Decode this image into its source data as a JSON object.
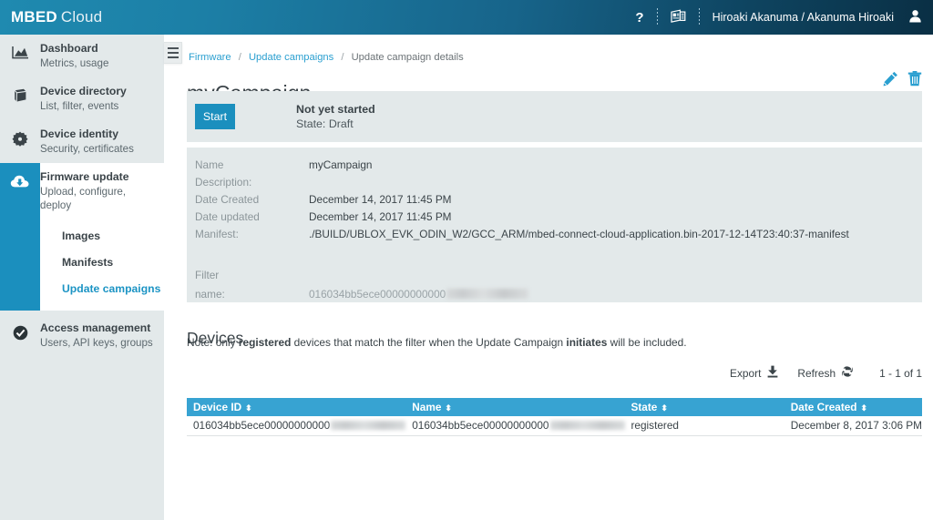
{
  "topbar": {
    "brand_bold": "MBED",
    "brand_light": "Cloud",
    "help_label": "?",
    "news_icon": "newspaper-icon",
    "user_name": "Hiroaki Akanuma / Akanuma Hiroaki",
    "avatar_icon": "user-avatar-icon",
    "gradient_from": "#1f8ab0",
    "gradient_to": "#0a2f44"
  },
  "sidebar": {
    "items": [
      {
        "icon": "area-chart-icon",
        "title": "Dashboard",
        "sub": "Metrics, usage"
      },
      {
        "icon": "book-icon",
        "title": "Device directory",
        "sub": "List, filter, events"
      },
      {
        "icon": "gear-badge-icon",
        "title": "Device identity",
        "sub": "Security, certificates"
      },
      {
        "icon": "cloud-download-icon",
        "title": "Firmware update",
        "sub": "Upload, configure, deploy"
      },
      {
        "icon": "check-circle-icon",
        "title": "Access management",
        "sub": "Users, API keys, groups"
      }
    ],
    "subitems": [
      {
        "label": "Images",
        "current": false
      },
      {
        "label": "Manifests",
        "current": false
      },
      {
        "label": "Update campaigns",
        "current": true
      }
    ],
    "active_color": "#1b8fbe",
    "bg_color": "#e3e9ea"
  },
  "breadcrumb": {
    "items": [
      {
        "label": "Firmware",
        "link": true
      },
      {
        "label": "Update campaigns",
        "link": true
      },
      {
        "label": "Update campaign details",
        "link": false
      }
    ],
    "separator": "/"
  },
  "page": {
    "title": "myCampaign",
    "edit_icon": "pencil-icon",
    "delete_icon": "trash-icon",
    "accent_color": "#2a9fd0"
  },
  "status": {
    "start_label": "Start",
    "headline": "Not yet started",
    "state": "State: Draft"
  },
  "details": {
    "rows": [
      {
        "label": "Name",
        "value": "myCampaign"
      },
      {
        "label": "Description:",
        "value": ""
      },
      {
        "label": "Date Created",
        "value": "December 14, 2017 11:45 PM"
      },
      {
        "label": "Date updated",
        "value": "December 14, 2017 11:45 PM"
      },
      {
        "label": "Manifest:",
        "value": "./BUILD/UBLOX_EVK_ODIN_W2/GCC_ARM/mbed-connect-cloud-application.bin-2017-12-14T23:40:37-manifest"
      }
    ],
    "filter_title": "Filter",
    "filter_label": "name:",
    "filter_value": "016034bb5ece00000000000"
  },
  "devices": {
    "section_title": "Devices",
    "note_prefix": "Note: only ",
    "note_bold1": "registered",
    "note_mid": " devices that match the filter when the Update Campaign ",
    "note_bold2": "initiates",
    "note_suffix": " will be included.",
    "export_label": "Export",
    "export_icon": "download-icon",
    "refresh_label": "Refresh",
    "refresh_icon": "refresh-icon",
    "pager": "1 - 1 of 1",
    "columns": [
      {
        "label": "Device ID",
        "sortable": true
      },
      {
        "label": "Name",
        "sortable": true
      },
      {
        "label": "State",
        "sortable": true
      },
      {
        "label": "Date Created",
        "sortable": true
      }
    ],
    "rows": [
      {
        "device_id": "016034bb5ece00000000000",
        "name": "016034bb5ece00000000000",
        "state": "registered",
        "date_created": "December 8, 2017 3:06 PM"
      }
    ],
    "header_color": "#37a3d2"
  }
}
